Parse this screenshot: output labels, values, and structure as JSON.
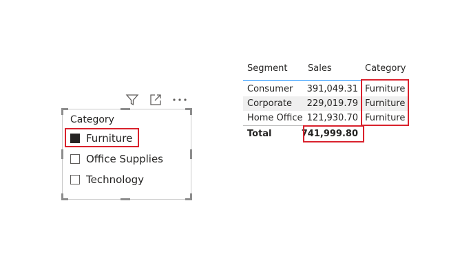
{
  "slicer": {
    "title": "Category",
    "items": [
      {
        "label": "Furniture",
        "checked": true
      },
      {
        "label": "Office Supplies",
        "checked": false
      },
      {
        "label": "Technology",
        "checked": false
      }
    ],
    "header_icons": [
      "filter-icon",
      "focus-mode-icon",
      "more-options-icon"
    ]
  },
  "table": {
    "headers": {
      "segment": "Segment",
      "sales": "Sales",
      "category": "Category"
    },
    "rows": [
      {
        "segment": "Consumer",
        "sales": "391,049.31",
        "category": "Furniture"
      },
      {
        "segment": "Corporate",
        "sales": "229,019.79",
        "category": "Furniture"
      },
      {
        "segment": "Home Office",
        "sales": "121,930.70",
        "category": "Furniture"
      }
    ],
    "total": {
      "label": "Total",
      "sales": "741,999.80"
    }
  },
  "colors": {
    "highlight": "#d9212c",
    "header_underline": "#118dff",
    "alt_row": "#efefef",
    "text": "#252423"
  }
}
